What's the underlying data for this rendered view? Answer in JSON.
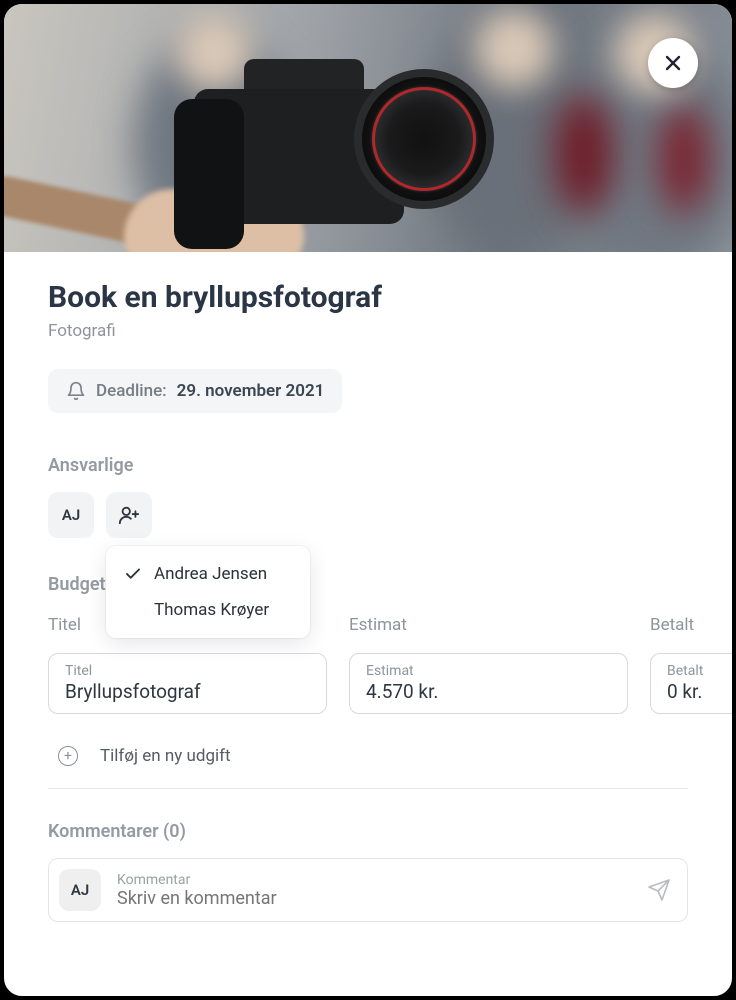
{
  "header": {
    "title": "Book en bryllupsfotograf",
    "category": "Fotografi"
  },
  "deadline": {
    "label": "Deadline:",
    "date": "29. november 2021"
  },
  "assignees": {
    "section_label": "Ansvarlige",
    "avatar_initials": "AJ",
    "dropdown": [
      {
        "name": "Andrea Jensen",
        "selected": true
      },
      {
        "name": "Thomas Krøyer",
        "selected": false
      }
    ]
  },
  "budget": {
    "section_label": "Budget",
    "columns": {
      "title": {
        "head": "Titel",
        "field_label": "Titel",
        "value": "Bryllupsfotograf"
      },
      "estimate": {
        "head": "Estimat",
        "field_label": "Estimat",
        "value": "4.570 kr."
      },
      "paid": {
        "head": "Betalt",
        "field_label": "Betalt",
        "value": "0 kr."
      }
    },
    "add_expense_label": "Tilføj en ny udgift"
  },
  "comments": {
    "section_label": "Kommentarer (0)",
    "avatar_initials": "AJ",
    "field_label": "Kommentar",
    "placeholder": "Skriv en kommentar"
  }
}
